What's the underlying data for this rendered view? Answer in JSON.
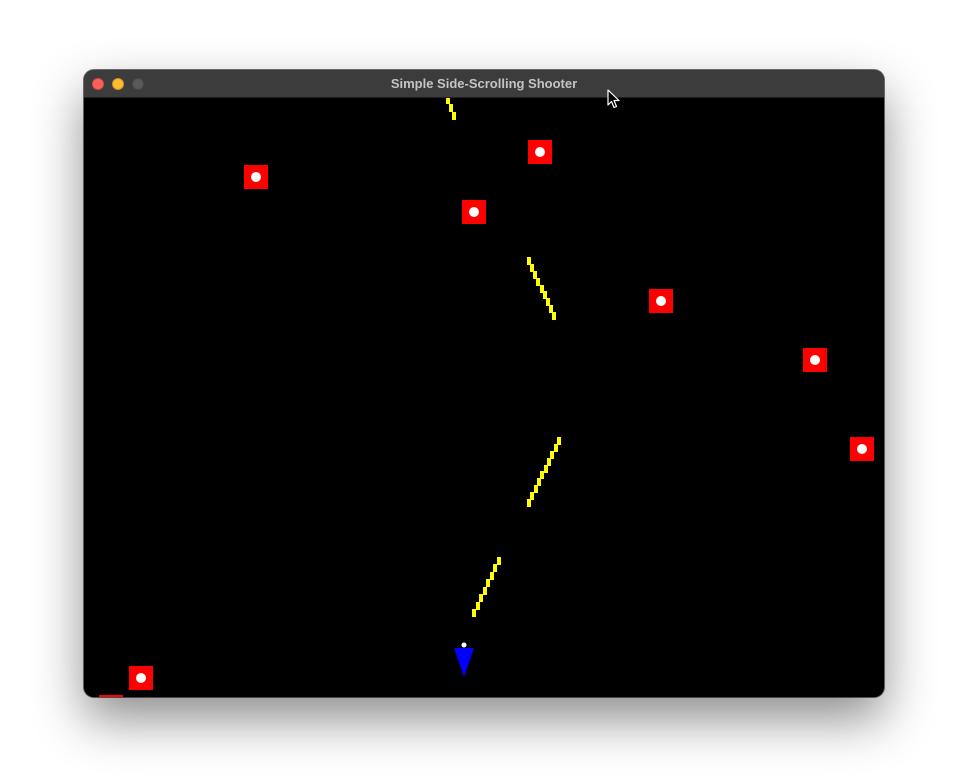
{
  "window": {
    "title": "Simple Side-Scrolling Shooter",
    "buttons": {
      "close_color": "#ff5f57",
      "minimize_color": "#febc2e",
      "zoom_color": "#5a5a5a"
    }
  },
  "game": {
    "background_color": "#000000",
    "enemy_color": "#ff0000",
    "enemy_core_color": "#ffffff",
    "bullet_color": "#ffff00",
    "player_color": "#0000ff",
    "enemy_count": 8,
    "bullet_trail_count": 4,
    "player_icon": "triangle-ship-icon",
    "enemy_icon": "red-square-enemy-icon"
  }
}
